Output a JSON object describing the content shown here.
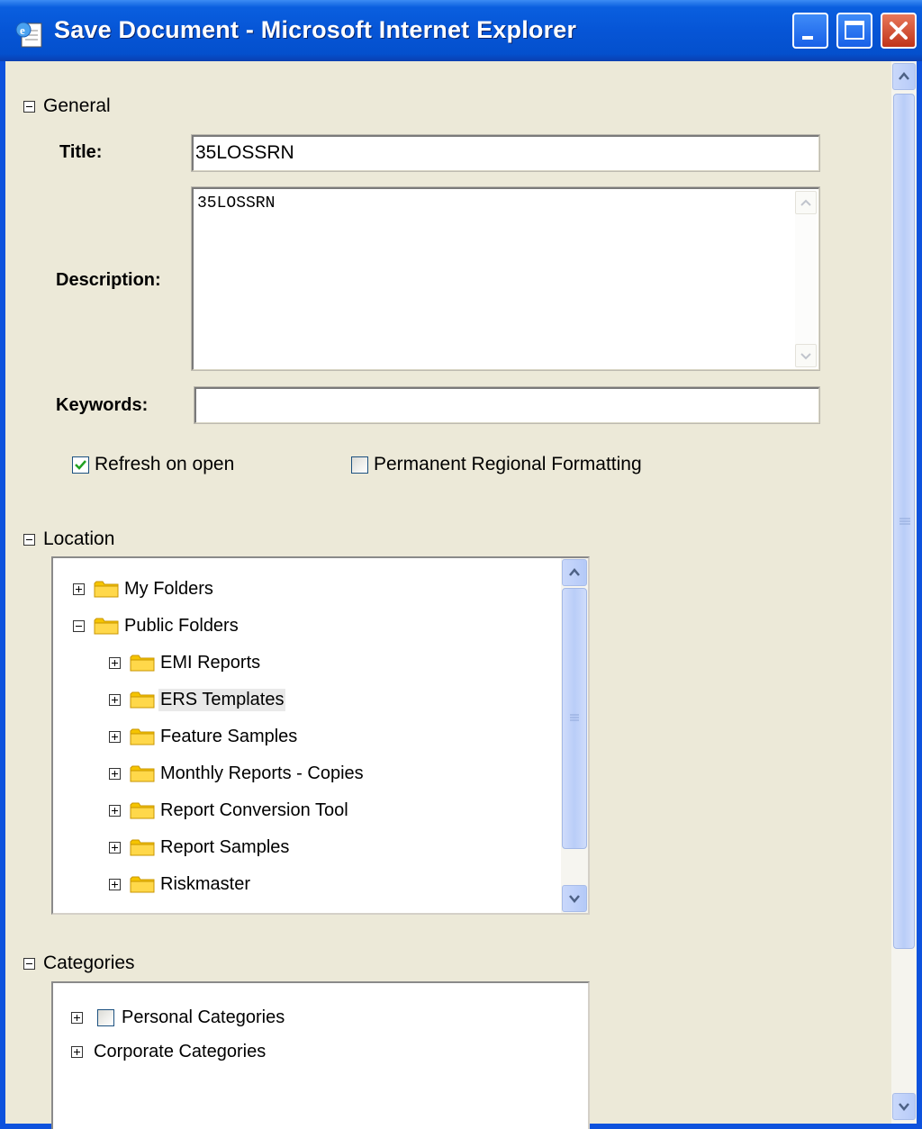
{
  "window": {
    "title": "Save Document - Microsoft Internet Explorer",
    "icon": "ie-page-icon",
    "controls": [
      "minimize",
      "maximize",
      "close"
    ]
  },
  "general": {
    "heading": "General",
    "title_label": "Title:",
    "title_value": "35LOSSRN",
    "description_label": "Description:",
    "description_value": "35LOSSRN",
    "keywords_label": "Keywords:",
    "keywords_value": "",
    "refresh_label": "Refresh on open",
    "refresh_checked": true,
    "regional_label": "Permanent Regional Formatting",
    "regional_checked": false
  },
  "location": {
    "heading": "Location",
    "tree": [
      {
        "label": "My Folders",
        "level": 0,
        "expanded": false
      },
      {
        "label": "Public Folders",
        "level": 0,
        "expanded": true
      },
      {
        "label": "EMI Reports",
        "level": 1,
        "expanded": false
      },
      {
        "label": "ERS Templates",
        "level": 1,
        "expanded": false,
        "selected": true
      },
      {
        "label": "Feature Samples",
        "level": 1,
        "expanded": false
      },
      {
        "label": "Monthly Reports - Copies",
        "level": 1,
        "expanded": false
      },
      {
        "label": "Report Conversion Tool",
        "level": 1,
        "expanded": false
      },
      {
        "label": "Report Samples",
        "level": 1,
        "expanded": false
      },
      {
        "label": "Riskmaster",
        "level": 1,
        "expanded": false
      }
    ]
  },
  "categories": {
    "heading": "Categories",
    "tree": [
      {
        "label": "Personal Categories",
        "has_checkbox": true
      },
      {
        "label": "Corporate Categories",
        "has_checkbox": false
      }
    ]
  },
  "colors": {
    "titlebar": "#0655d6",
    "window_bg": "#ece9d8",
    "check_green": "#21a121"
  }
}
